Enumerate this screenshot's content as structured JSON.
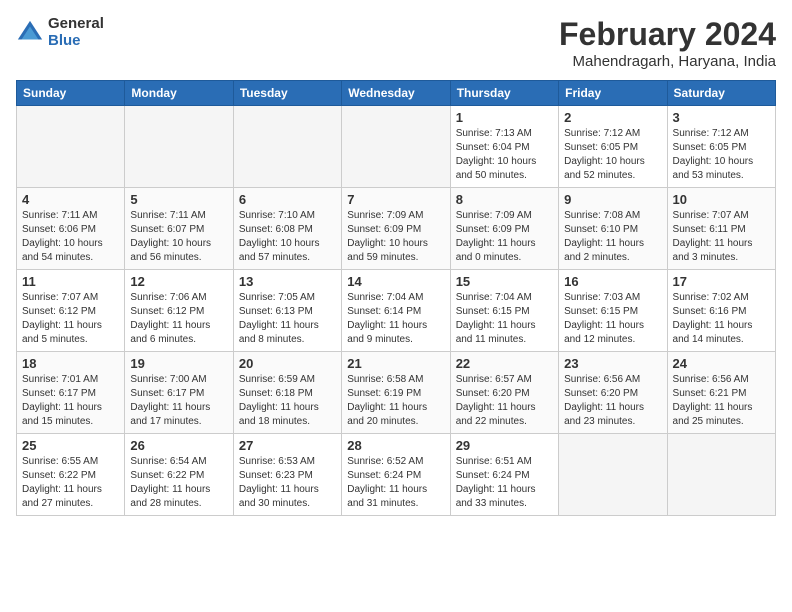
{
  "logo": {
    "general": "General",
    "blue": "Blue"
  },
  "title": "February 2024",
  "location": "Mahendragarh, Haryana, India",
  "days_of_week": [
    "Sunday",
    "Monday",
    "Tuesday",
    "Wednesday",
    "Thursday",
    "Friday",
    "Saturday"
  ],
  "weeks": [
    [
      {
        "day": "",
        "info": ""
      },
      {
        "day": "",
        "info": ""
      },
      {
        "day": "",
        "info": ""
      },
      {
        "day": "",
        "info": ""
      },
      {
        "day": "1",
        "info": "Sunrise: 7:13 AM\nSunset: 6:04 PM\nDaylight: 10 hours\nand 50 minutes."
      },
      {
        "day": "2",
        "info": "Sunrise: 7:12 AM\nSunset: 6:05 PM\nDaylight: 10 hours\nand 52 minutes."
      },
      {
        "day": "3",
        "info": "Sunrise: 7:12 AM\nSunset: 6:05 PM\nDaylight: 10 hours\nand 53 minutes."
      }
    ],
    [
      {
        "day": "4",
        "info": "Sunrise: 7:11 AM\nSunset: 6:06 PM\nDaylight: 10 hours\nand 54 minutes."
      },
      {
        "day": "5",
        "info": "Sunrise: 7:11 AM\nSunset: 6:07 PM\nDaylight: 10 hours\nand 56 minutes."
      },
      {
        "day": "6",
        "info": "Sunrise: 7:10 AM\nSunset: 6:08 PM\nDaylight: 10 hours\nand 57 minutes."
      },
      {
        "day": "7",
        "info": "Sunrise: 7:09 AM\nSunset: 6:09 PM\nDaylight: 10 hours\nand 59 minutes."
      },
      {
        "day": "8",
        "info": "Sunrise: 7:09 AM\nSunset: 6:09 PM\nDaylight: 11 hours\nand 0 minutes."
      },
      {
        "day": "9",
        "info": "Sunrise: 7:08 AM\nSunset: 6:10 PM\nDaylight: 11 hours\nand 2 minutes."
      },
      {
        "day": "10",
        "info": "Sunrise: 7:07 AM\nSunset: 6:11 PM\nDaylight: 11 hours\nand 3 minutes."
      }
    ],
    [
      {
        "day": "11",
        "info": "Sunrise: 7:07 AM\nSunset: 6:12 PM\nDaylight: 11 hours\nand 5 minutes."
      },
      {
        "day": "12",
        "info": "Sunrise: 7:06 AM\nSunset: 6:12 PM\nDaylight: 11 hours\nand 6 minutes."
      },
      {
        "day": "13",
        "info": "Sunrise: 7:05 AM\nSunset: 6:13 PM\nDaylight: 11 hours\nand 8 minutes."
      },
      {
        "day": "14",
        "info": "Sunrise: 7:04 AM\nSunset: 6:14 PM\nDaylight: 11 hours\nand 9 minutes."
      },
      {
        "day": "15",
        "info": "Sunrise: 7:04 AM\nSunset: 6:15 PM\nDaylight: 11 hours\nand 11 minutes."
      },
      {
        "day": "16",
        "info": "Sunrise: 7:03 AM\nSunset: 6:15 PM\nDaylight: 11 hours\nand 12 minutes."
      },
      {
        "day": "17",
        "info": "Sunrise: 7:02 AM\nSunset: 6:16 PM\nDaylight: 11 hours\nand 14 minutes."
      }
    ],
    [
      {
        "day": "18",
        "info": "Sunrise: 7:01 AM\nSunset: 6:17 PM\nDaylight: 11 hours\nand 15 minutes."
      },
      {
        "day": "19",
        "info": "Sunrise: 7:00 AM\nSunset: 6:17 PM\nDaylight: 11 hours\nand 17 minutes."
      },
      {
        "day": "20",
        "info": "Sunrise: 6:59 AM\nSunset: 6:18 PM\nDaylight: 11 hours\nand 18 minutes."
      },
      {
        "day": "21",
        "info": "Sunrise: 6:58 AM\nSunset: 6:19 PM\nDaylight: 11 hours\nand 20 minutes."
      },
      {
        "day": "22",
        "info": "Sunrise: 6:57 AM\nSunset: 6:20 PM\nDaylight: 11 hours\nand 22 minutes."
      },
      {
        "day": "23",
        "info": "Sunrise: 6:56 AM\nSunset: 6:20 PM\nDaylight: 11 hours\nand 23 minutes."
      },
      {
        "day": "24",
        "info": "Sunrise: 6:56 AM\nSunset: 6:21 PM\nDaylight: 11 hours\nand 25 minutes."
      }
    ],
    [
      {
        "day": "25",
        "info": "Sunrise: 6:55 AM\nSunset: 6:22 PM\nDaylight: 11 hours\nand 27 minutes."
      },
      {
        "day": "26",
        "info": "Sunrise: 6:54 AM\nSunset: 6:22 PM\nDaylight: 11 hours\nand 28 minutes."
      },
      {
        "day": "27",
        "info": "Sunrise: 6:53 AM\nSunset: 6:23 PM\nDaylight: 11 hours\nand 30 minutes."
      },
      {
        "day": "28",
        "info": "Sunrise: 6:52 AM\nSunset: 6:24 PM\nDaylight: 11 hours\nand 31 minutes."
      },
      {
        "day": "29",
        "info": "Sunrise: 6:51 AM\nSunset: 6:24 PM\nDaylight: 11 hours\nand 33 minutes."
      },
      {
        "day": "",
        "info": ""
      },
      {
        "day": "",
        "info": ""
      }
    ]
  ]
}
